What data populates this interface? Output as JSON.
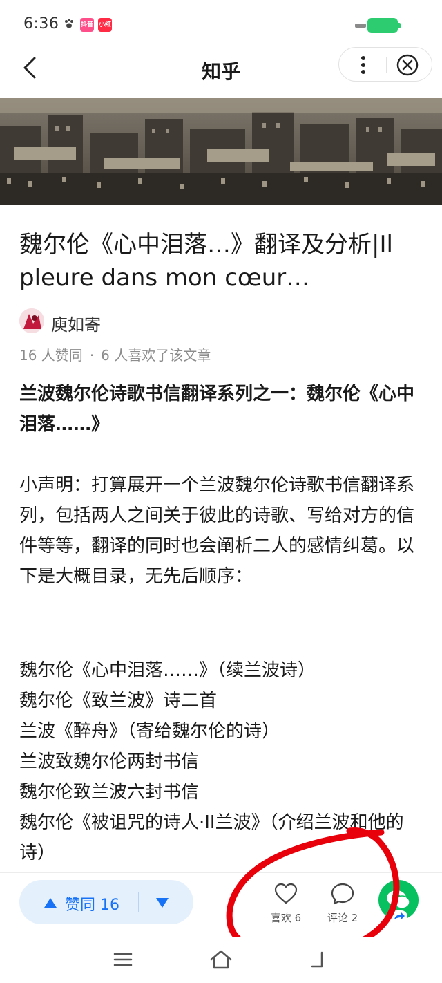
{
  "status_bar": {
    "time": "6:36",
    "badge_1": "抖音",
    "badge_2": "小红书"
  },
  "nav": {
    "title": "知乎",
    "back_icon": "chevron-left-icon",
    "more_icon": "more-vertical-icon",
    "close_icon": "close-circle-icon"
  },
  "article": {
    "title": "魏尔伦《心中泪落…》翻译及分析|Il pleure dans mon cœur…",
    "author": "庾如寄",
    "upvotes_text": "16 人赞同",
    "likes_text": "6 人喜欢了该文章",
    "subheading": "兰波魏尔伦诗歌书信翻译系列之一：魏尔伦《心中泪落……》",
    "paragraph": "小声明：打算展开一个兰波魏尔伦诗歌书信翻译系列，包括两人之间关于彼此的诗歌、写给对方的信件等等，翻译的同时也会阐析二人的感情纠葛。以下是大概目录，无先后顺序：",
    "toc": [
      "魏尔伦《心中泪落……》（续兰波诗）",
      "魏尔伦《致兰波》诗二首",
      "兰波《醉舟》（寄给魏尔伦的诗）",
      "兰波致魏尔伦两封书信",
      "魏尔伦致兰波六封书信",
      "魏尔伦《被诅咒的诗人·II兰波》（介绍兰波和他的诗）"
    ]
  },
  "action_bar": {
    "upvote_label": "赞同 16",
    "like_label": "喜欢 6",
    "comment_label": "评论 2",
    "like_icon": "heart-icon",
    "comment_icon": "comment-bubble-icon",
    "share_icon": "wechat-share-icon"
  },
  "colors": {
    "accent": "#1772f6",
    "accent_bg": "#e5f0fd",
    "wechat_green": "#07c160",
    "battery_green": "#2ecc71",
    "annotation_red": "#e8000b"
  }
}
